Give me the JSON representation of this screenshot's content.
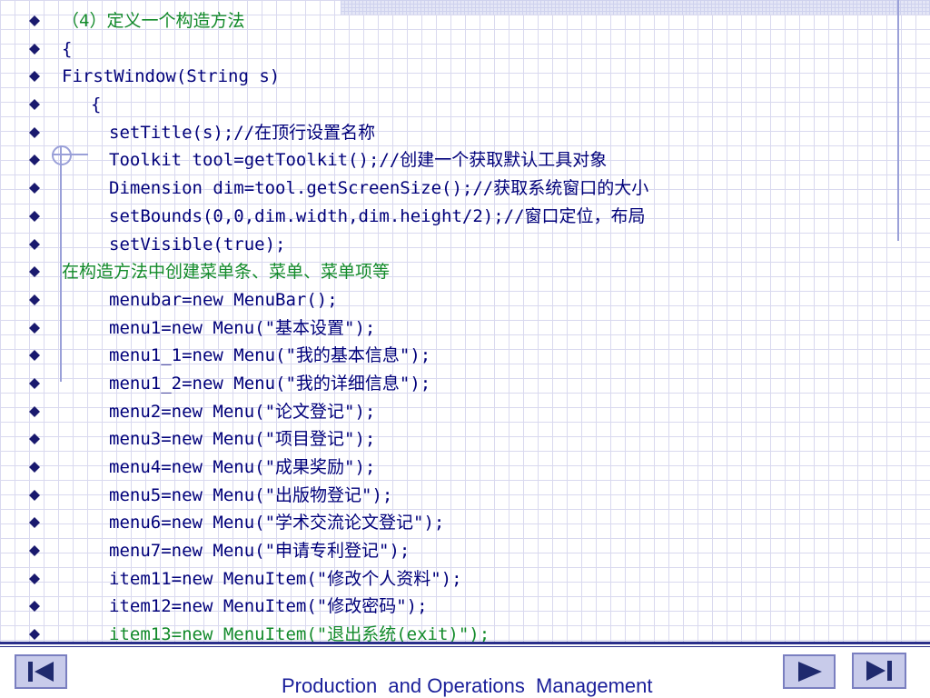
{
  "colors": {
    "code": "#00007a",
    "comment_green": "#128a2a",
    "bullet": "#1a1a6e",
    "nav_button": "#c8cbea",
    "footer_text": "#1a1f9a"
  },
  "lines": [
    {
      "text": "（4）定义一个构造方法",
      "indent": 0,
      "style": "head"
    },
    {
      "text": "{",
      "indent": 0,
      "style": "navy"
    },
    {
      "text": "FirstWindow(String s)",
      "indent": 0,
      "style": "navy"
    },
    {
      "text": "{",
      "indent": 1,
      "style": "navy"
    },
    {
      "text": "setTitle(s);//在顶行设置名称",
      "indent": 2,
      "style": "navy"
    },
    {
      "text": "Toolkit tool=getToolkit();//创建一个获取默认工具对象",
      "indent": 2,
      "style": "navy"
    },
    {
      "text": "Dimension dim=tool.getScreenSize();//获取系统窗口的大小",
      "indent": 2,
      "style": "navy"
    },
    {
      "text": "setBounds(0,0,dim.width,dim.height/2);//窗口定位，布局",
      "indent": 2,
      "style": "navy"
    },
    {
      "text": "setVisible(true);",
      "indent": 2,
      "style": "navy"
    },
    {
      "text": "在构造方法中创建菜单条、菜单、菜单项等",
      "indent": 0,
      "style": "green"
    },
    {
      "text": "menubar=new MenuBar();",
      "indent": 2,
      "style": "navy"
    },
    {
      "text": "menu1=new Menu(\"基本设置\");",
      "indent": 2,
      "style": "navy"
    },
    {
      "text": "menu1_1=new Menu(\"我的基本信息\");",
      "indent": 2,
      "style": "navy"
    },
    {
      "text": "menu1_2=new Menu(\"我的详细信息\");",
      "indent": 2,
      "style": "navy"
    },
    {
      "text": "menu2=new Menu(\"论文登记\");",
      "indent": 2,
      "style": "navy"
    },
    {
      "text": "menu3=new Menu(\"项目登记\");",
      "indent": 2,
      "style": "navy"
    },
    {
      "text": "menu4=new Menu(\"成果奖励\");",
      "indent": 2,
      "style": "navy"
    },
    {
      "text": "menu5=new Menu(\"出版物登记\");",
      "indent": 2,
      "style": "navy"
    },
    {
      "text": "menu6=new Menu(\"学术交流论文登记\");",
      "indent": 2,
      "style": "navy"
    },
    {
      "text": "menu7=new Menu(\"申请专利登记\");",
      "indent": 2,
      "style": "navy"
    },
    {
      "text": "item11=new MenuItem(\"修改个人资料\");",
      "indent": 2,
      "style": "navy"
    },
    {
      "text": "item12=new MenuItem(\"修改密码\");",
      "indent": 2,
      "style": "navy"
    },
    {
      "text": "item13=new MenuItem(\"退出系统(exit)\");",
      "indent": 2,
      "style": "green"
    }
  ],
  "footer": {
    "title": "Production  and Operations  Management"
  },
  "nav": {
    "first_icon": "first-slide-icon",
    "prev_icon": "previous-slide-icon",
    "next_icon": "next-slide-icon",
    "last_icon": "last-slide-icon"
  }
}
